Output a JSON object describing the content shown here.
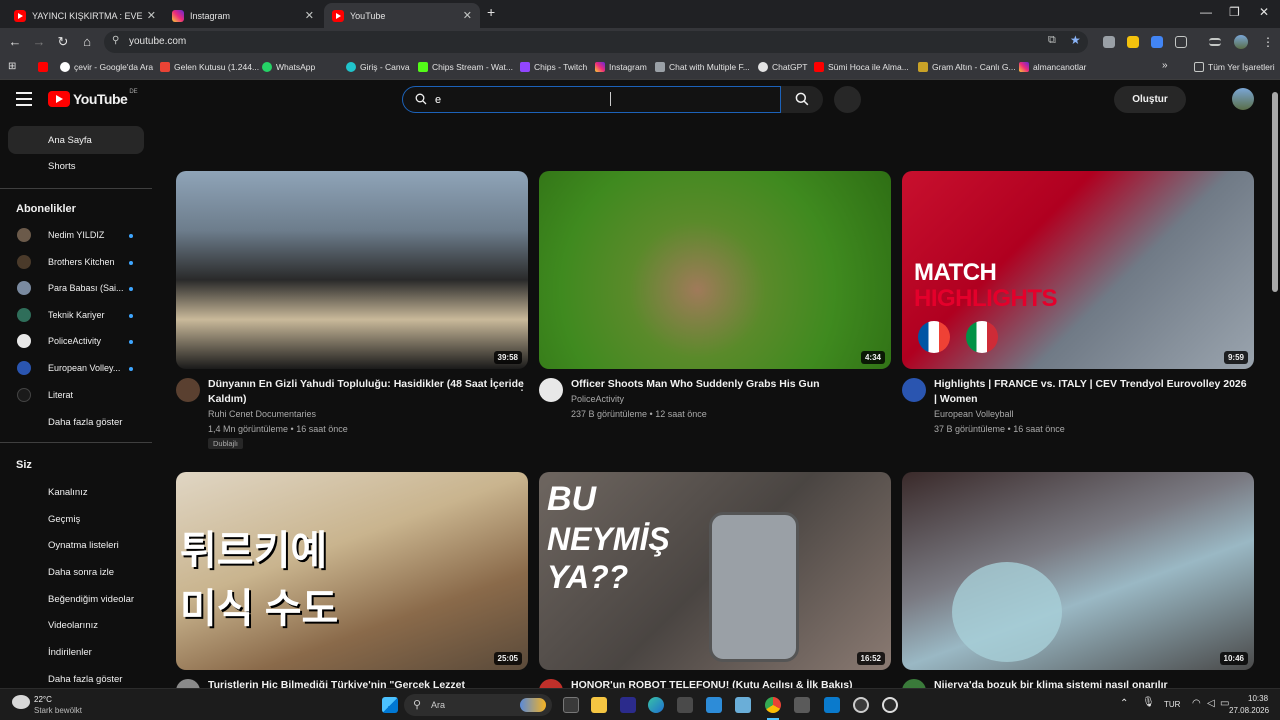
{
  "browser": {
    "tabs": [
      {
        "title": "YAYINCI KIŞKIRTMA : EVE DÖNÜ",
        "icon": "youtube-icon",
        "active": false
      },
      {
        "title": "Instagram",
        "icon": "instagram-icon",
        "active": false
      },
      {
        "title": "YouTube",
        "icon": "youtube-icon",
        "active": true
      }
    ],
    "new_tab": "+",
    "url": "youtube.com",
    "bookmarks": [
      "çevir - Google'da Ara",
      "Gelen Kutusu (1.244...",
      "WhatsApp",
      "Giriş - Canva",
      "Chips Stream - Wat...",
      "Chips - Twitch",
      "Instagram",
      "Chat with Multiple F...",
      "ChatGPT",
      "Sümi Hoca ile Alma...",
      "Gram Altın - Canlı G...",
      "almancanotlar"
    ],
    "bookmarks_more": "»",
    "all_bookmarks": "Tüm Yer İşaretleri"
  },
  "youtube": {
    "logo": "YouTube",
    "country": "DE",
    "search_value": "e",
    "create_label": "Oluştur",
    "sidebar": {
      "main": [
        "Ana Sayfa",
        "Shorts"
      ],
      "subs_heading": "Abonelikler",
      "subscriptions": [
        {
          "name": "Nedim YILDIZ",
          "color": "#6b5a4a",
          "dot": true
        },
        {
          "name": "Brothers Kitchen",
          "color": "#4a3a2a",
          "dot": true
        },
        {
          "name": "Para Babası (Sai...",
          "color": "#7a8aa0",
          "dot": true
        },
        {
          "name": "Teknik Kariyer",
          "color": "#2f6e5a",
          "dot": true
        },
        {
          "name": "PoliceActivity",
          "color": "#e8e8e8",
          "dot": true
        },
        {
          "name": "European Volley...",
          "color": "#2a55b0",
          "dot": true
        },
        {
          "name": "Literat",
          "color": "#1a1a1a",
          "dot": false
        }
      ],
      "show_more": "Daha fazla göster",
      "you_heading": "Siz",
      "you_items": [
        "Kanalınız",
        "Geçmiş",
        "Oynatma listeleri",
        "Daha sonra izle",
        "Beğendiğim videolar",
        "Videolarınız",
        "İndirilenler",
        "Daha fazla göster"
      ]
    },
    "videos": [
      {
        "title": "Dünyanın En Gizli Yahudi Topluluğu: Hasidikler (48 Saat İçeride Kaldım)",
        "channel": "Ruhi Cenet Documentaries",
        "meta": "1,4 Mn görüntüleme • 16 saat önce",
        "badge": "Dublajlı",
        "duration": "39:58",
        "thumb": "linear-gradient(180deg,#8fa4b8 0%,#6d7d8c 30%,#2a2a2a 55%,#c9b99a 75%,#1a1a1a 100%)",
        "avatar": "#5a4030"
      },
      {
        "title": "Officer Shoots Man Who Suddenly Grabs His Gun",
        "channel": "PoliceActivity",
        "meta": "237 B görüntüleme • 12 saat önce",
        "badge": "",
        "duration": "4:34",
        "thumb": "radial-gradient(circle at 45% 60%,#a07a5a 0%,#5a8a2a 30%,#3f8a1f 60%,#2e6e14 100%)",
        "avatar": "#e8e8e8"
      },
      {
        "title": "Highlights | FRANCE vs. ITALY | CEV Trendyol Eurovolley 2026 | Women",
        "channel": "European Volleyball",
        "meta": "37 B görüntüleme • 16 saat önce",
        "badge": "",
        "duration": "9:59",
        "thumb": "linear-gradient(135deg,#c8102e 0%,#b00020 35%,#707a86 60%,#9aa4ae 100%)",
        "avatar": "#2a55b0",
        "overlay_top": "MATCH",
        "overlay_bottom": "HIGHLIGHTS"
      },
      {
        "title": "Turistlerin Hiç Bilmediği Türkiye'nin \"Gerçek Lezzet",
        "channel": "",
        "meta": "",
        "badge": "",
        "duration": "25:05",
        "thumb": "linear-gradient(160deg,#e0d6c4 0%,#c9b48e 40%,#8a6a4a 70%,#5a4a3a 100%)",
        "avatar": "#8a8a8a",
        "overlay_top": "튀르키예",
        "overlay_bottom": "미식 수도"
      },
      {
        "title": "HONOR'un ROBOT TELEFONU! (Kutu Açılışı & İlk Bakış)",
        "channel": "",
        "meta": "",
        "badge": "",
        "duration": "16:52",
        "thumb": "linear-gradient(135deg,#6e6660 0%,#4a4542 50%,#8a7a72 100%)",
        "avatar": "#c0302a",
        "overlay_top": "BU",
        "overlay_bottom": "NEYMİŞ YA??"
      },
      {
        "title": "Nijerya'da bozuk bir klima sistemi nasıl onarılır",
        "channel": "",
        "meta": "",
        "badge": "",
        "duration": "10:46",
        "thumb": "linear-gradient(160deg,#3a2a2a 0%,#7a7a82 40%,#9ab8c4 60%,#4a4a4a 100%)",
        "avatar": "#3a7a3a"
      }
    ]
  },
  "taskbar": {
    "weather_temp": "22°C",
    "weather_desc": "Stark bewölkt",
    "search": "Ara",
    "lang": "TUR",
    "time": "10:38",
    "date": "27.08.2026"
  }
}
